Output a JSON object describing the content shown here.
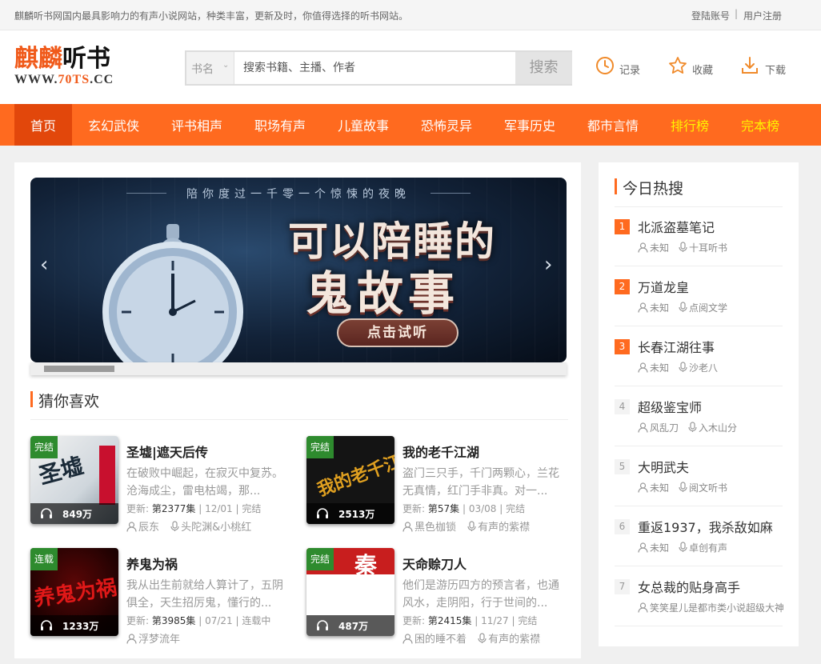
{
  "topbar": {
    "tagline": "麒麟听书网国内最具影响力的有声小说网站，种类丰富，更新及时，你值得选择的听书网站。",
    "login": "登陆账号",
    "separator": "|",
    "register": "用户注册"
  },
  "logo": {
    "name_red": "麒麟",
    "name_black": "听书",
    "url_a": "WWW.",
    "url_b": "70TS",
    "url_c": ".CC"
  },
  "search": {
    "category": "书名",
    "placeholder": "搜索书籍、主播、作者",
    "button": "搜索"
  },
  "header_links": [
    {
      "label": "记录",
      "icon": "clock-icon"
    },
    {
      "label": "收藏",
      "icon": "star-icon"
    },
    {
      "label": "下载",
      "icon": "download-icon"
    }
  ],
  "nav": [
    "首页",
    "玄幻武侠",
    "评书相声",
    "职场有声",
    "儿童故事",
    "恐怖灵异",
    "军事历史",
    "都市言情",
    "排行榜",
    "完本榜"
  ],
  "banner": {
    "tagline": "陪你度过一千零一个惊悚的夜晚",
    "headline1": "可以陪睡的",
    "headline2": "鬼故事",
    "cta": "点击试听"
  },
  "section": {
    "title": "猜你喜欢"
  },
  "books": [
    {
      "status": "完结",
      "plays": "849万",
      "title": "圣墟|遮天后传",
      "desc": "在破败中崛起，在寂灭中复苏。沧海成尘，雷电枯竭，那...",
      "update_label": "更新:",
      "episodes": "第2377集",
      "date": "| 12/01 | 完结",
      "author": "辰东",
      "narrator": "头陀渊&小桃红",
      "cover_text": "圣墟"
    },
    {
      "status": "完结",
      "plays": "2513万",
      "title": "我的老千江湖",
      "desc": "盗门三只手，千门两颗心，兰花无真情，红门手非真。对一...",
      "update_label": "更新:",
      "episodes": "第57集",
      "date": "| 03/08 | 完结",
      "author": "黑色枷锁",
      "narrator": "有声的紫襟",
      "cover_text": "我的老千江湖"
    },
    {
      "status": "连载",
      "plays": "1233万",
      "title": "养鬼为祸",
      "desc": "我从出生前就给人算计了，五阴俱全，天生招厉鬼，懂行的...",
      "update_label": "更新:",
      "episodes": "第3985集",
      "date": "| 07/21 | 连载中",
      "author": "浮梦流年",
      "narrator": "",
      "cover_text": "养鬼为祸"
    },
    {
      "status": "完结",
      "plays": "487万",
      "title": "天命赊刀人",
      "desc": "他们是游历四方的预言者，也通风水，走阴阳，行于世间的...",
      "update_label": "更新:",
      "episodes": "第2415集",
      "date": "| 11/27 | 完结",
      "author": "困的睡不着",
      "narrator": "有声的紫襟",
      "cover_text": "秦"
    }
  ],
  "sidebar": {
    "title": "今日热搜",
    "items": [
      {
        "rank": "1",
        "name": "北派盗墓笔记",
        "author": "未知",
        "narrator": "十耳听书"
      },
      {
        "rank": "2",
        "name": "万道龙皇",
        "author": "未知",
        "narrator": "点阅文学"
      },
      {
        "rank": "3",
        "name": "长春江湖往事",
        "author": "未知",
        "narrator": "沙老八"
      },
      {
        "rank": "4",
        "name": "超级鉴宝师",
        "author": "风乱刀",
        "narrator": "入木山分"
      },
      {
        "rank": "5",
        "name": "大明武夫",
        "author": "未知",
        "narrator": "阅文听书"
      },
      {
        "rank": "6",
        "name": "重返1937，我杀敌如麻",
        "author": "未知",
        "narrator": "卓创有声"
      },
      {
        "rank": "7",
        "name": "女总裁的贴身高手",
        "author": "笑笑星儿是都市类小说超级大神",
        "narrator": ""
      }
    ]
  },
  "colors": {
    "accent": "#ff6a1f",
    "nav_active": "#e2470b",
    "nav_highlight": "#fff200",
    "status_green": "#2e8b2e"
  }
}
